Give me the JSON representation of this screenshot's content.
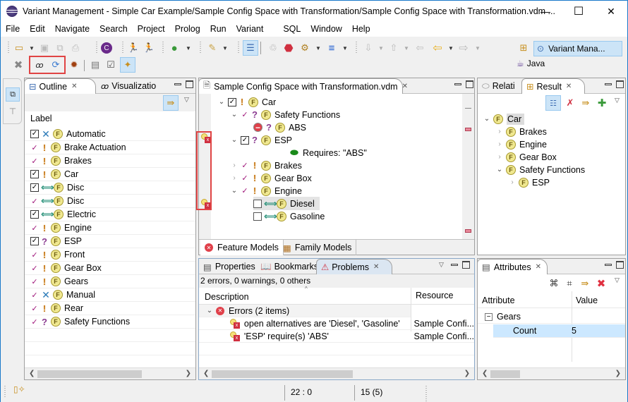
{
  "window": {
    "title": "Variant Management - Simple Car Example/Sample Config Space with Transformation/Sample Config Space with Transformation.vdm ...",
    "minimize": "—",
    "maximize": "☐",
    "close": "✕"
  },
  "menu": [
    "File",
    "Edit",
    "Navigate",
    "Search",
    "Project",
    "Prolog",
    "Run",
    "Variant",
    "SQL",
    "Window",
    "Help"
  ],
  "perspectives": {
    "active": "Variant Mana...",
    "other": "Java"
  },
  "toolbar": {
    "icons": [
      "new-wizard",
      "save",
      "save-all",
      "print",
      "prolog",
      "run-variant",
      "run-variant-2",
      "run-debug",
      "marker-pen",
      "view-list",
      "transform",
      "stop",
      "gears",
      "blue-lines",
      "next-annotation",
      "prev-annotation",
      "back-history",
      "back",
      "forward",
      "delete",
      "visualization-glasses",
      "sync-refresh",
      "gear-bug",
      "save-model",
      "checklist",
      "active-tool"
    ]
  },
  "outline": {
    "tab_outline": "Outline",
    "tab_visualization": "Visualizatio",
    "column": "Label",
    "items": [
      {
        "label": "Automatic",
        "sel": "checked",
        "type": "excluded"
      },
      {
        "label": "Brake Actuation",
        "sel": "implicit",
        "type": "mandatory"
      },
      {
        "label": "Brakes",
        "sel": "implicit",
        "type": "mandatory"
      },
      {
        "label": "Car",
        "sel": "checked",
        "type": "mandatory"
      },
      {
        "label": "Disc",
        "sel": "checked",
        "type": "alternative"
      },
      {
        "label": "Disc",
        "sel": "implicit",
        "type": "alternative"
      },
      {
        "label": "Electric",
        "sel": "checked",
        "type": "alternative"
      },
      {
        "label": "Engine",
        "sel": "implicit",
        "type": "mandatory"
      },
      {
        "label": "ESP",
        "sel": "checked",
        "type": "optional"
      },
      {
        "label": "Front",
        "sel": "implicit",
        "type": "mandatory"
      },
      {
        "label": "Gear Box",
        "sel": "implicit",
        "type": "mandatory"
      },
      {
        "label": "Gears",
        "sel": "implicit",
        "type": "mandatory"
      },
      {
        "label": "Manual",
        "sel": "implicit",
        "type": "excluded"
      },
      {
        "label": "Rear",
        "sel": "implicit",
        "type": "mandatory"
      },
      {
        "label": "Safety Functions",
        "sel": "implicit",
        "type": "optional"
      }
    ]
  },
  "editor": {
    "tab": "Sample Config Space with Transformation.vdm",
    "tree": [
      {
        "label": "Car",
        "level": 0,
        "exp": "open",
        "sel": "checked",
        "type": "mandatory"
      },
      {
        "label": "Safety Functions",
        "level": 1,
        "exp": "open",
        "sel": "implicit",
        "type": "optional"
      },
      {
        "label": "ABS",
        "level": 2,
        "exp": "none",
        "sel": "blocked",
        "type": "optional"
      },
      {
        "label": "ESP",
        "level": 1,
        "exp": "open",
        "sel": "checked",
        "type": "optional",
        "offset": 1
      },
      {
        "label": "Requires: \"ABS\"",
        "level": 4,
        "exp": "none",
        "sel": "none",
        "type": "relation"
      },
      {
        "label": "Brakes",
        "level": 1,
        "exp": "closed",
        "sel": "implicit",
        "type": "mandatory"
      },
      {
        "label": "Gear Box",
        "level": 1,
        "exp": "closed",
        "sel": "implicit",
        "type": "mandatory"
      },
      {
        "label": "Engine",
        "level": 1,
        "exp": "open",
        "sel": "implicit",
        "type": "mandatory"
      },
      {
        "label": "Diesel",
        "level": 2,
        "exp": "none",
        "sel": "empty",
        "type": "alternative",
        "highlight": true
      },
      {
        "label": "Gasoline",
        "level": 2,
        "exp": "none",
        "sel": "empty",
        "type": "alternative"
      }
    ],
    "bottom_tabs": [
      "Feature Models",
      "Family Models"
    ]
  },
  "result": {
    "tab_relations": "Relati",
    "tab_result": "Result",
    "tree": [
      {
        "label": "Car",
        "level": 0,
        "exp": "open",
        "highlight": true
      },
      {
        "label": "Brakes",
        "level": 1,
        "exp": "closed"
      },
      {
        "label": "Engine",
        "level": 1,
        "exp": "closed"
      },
      {
        "label": "Gear Box",
        "level": 1,
        "exp": "closed"
      },
      {
        "label": "Safety Functions",
        "level": 1,
        "exp": "open"
      },
      {
        "label": "ESP",
        "level": 2,
        "exp": "closed"
      }
    ]
  },
  "problems": {
    "tabs": [
      "Properties",
      "Bookmarks",
      "Problems"
    ],
    "summary": "2 errors, 0 warnings, 0 others",
    "columns": [
      "Description",
      "Resource"
    ],
    "group": "Errors (2 items)",
    "rows": [
      {
        "description": " open alternatives are 'Diesel', 'Gasoline'",
        "resource": "Sample Confi..."
      },
      {
        "description": "'ESP' require(s) 'ABS'",
        "resource": "Sample Confi..."
      }
    ]
  },
  "attributes": {
    "tab": "Attributes",
    "columns": [
      "Attribute",
      "Value"
    ],
    "group": "Gears",
    "rows": [
      {
        "name": "Count",
        "value": "5"
      }
    ]
  },
  "status": {
    "position": "22 : 0",
    "count": "15 (5)"
  },
  "colors": {
    "accent": "#1979ca",
    "highlight_box": "#e04444",
    "selection": "#cce8ff"
  }
}
